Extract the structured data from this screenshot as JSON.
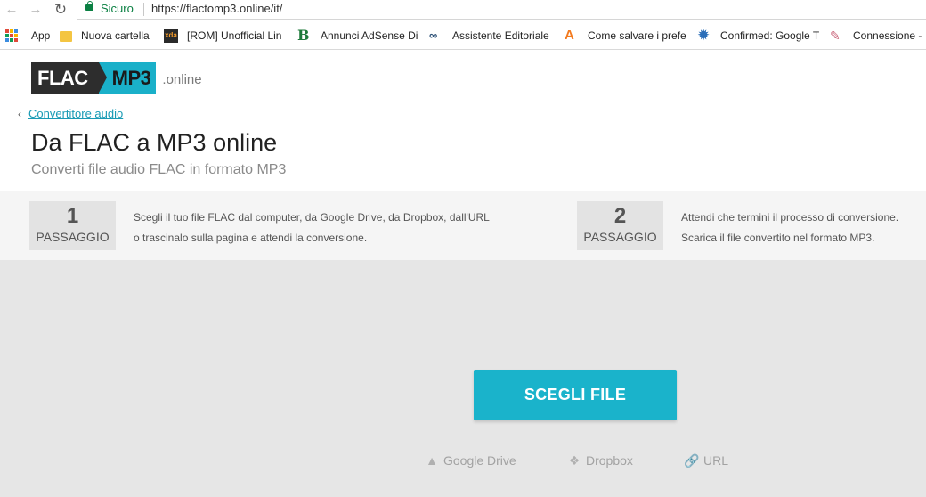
{
  "browser": {
    "secure_label": "Sicuro",
    "url": "https://flactomp3.online/it/",
    "nav": {
      "back": "←",
      "forward": "→",
      "reload": "↻"
    }
  },
  "bookmarks": [
    {
      "label": "App",
      "icon": "apps-icon"
    },
    {
      "label": "Nuova cartella",
      "icon": "folder-icon"
    },
    {
      "label": "[ROM] Unofficial Lin",
      "icon": "xda-icon",
      "icon_text": "xda"
    },
    {
      "label": "Annunci AdSense Di",
      "icon": "b-icon",
      "icon_text": "B"
    },
    {
      "label": "Assistente Editoriale",
      "icon": "infinity-icon",
      "icon_text": "∞"
    },
    {
      "label": "Come salvare i prefe",
      "icon": "a-icon",
      "icon_text": "A"
    },
    {
      "label": "Confirmed: Google T",
      "icon": "gear-icon",
      "icon_text": "✹"
    },
    {
      "label": "Connessione -",
      "icon": "connection-icon",
      "icon_text": "✎"
    }
  ],
  "logo": {
    "part1": "FLAC",
    "part2": "MP3",
    "suffix": ".online"
  },
  "breadcrumb": {
    "arrow": "‹",
    "link": "Convertitore audio"
  },
  "page": {
    "title": "Da FLAC a MP3 online",
    "subtitle": "Converti file audio FLAC in formato MP3"
  },
  "steps": [
    {
      "number": "1",
      "label": "PASSAGGIO",
      "line1": "Scegli il tuo file FLAC dal computer, da Google Drive, da Dropbox, dall'URL",
      "line2": "o trascinalo sulla pagina e attendi la conversione."
    },
    {
      "number": "2",
      "label": "PASSAGGIO",
      "line1": "Attendi che termini il processo di conversione.",
      "line2": "Scarica il file convertito nel formato MP3."
    }
  ],
  "upload": {
    "button": "SCEGLI FILE",
    "sources": [
      {
        "label": "Google Drive",
        "icon": "google-drive-icon",
        "glyph": "▲"
      },
      {
        "label": "Dropbox",
        "icon": "dropbox-icon",
        "glyph": "❖"
      },
      {
        "label": "URL",
        "icon": "link-icon",
        "glyph": "🔗"
      }
    ]
  },
  "colors": {
    "accent": "#1ab3cb",
    "logo_dark": "#2d2d2d",
    "secure_green": "#0b8043",
    "link": "#1a9bb5"
  }
}
